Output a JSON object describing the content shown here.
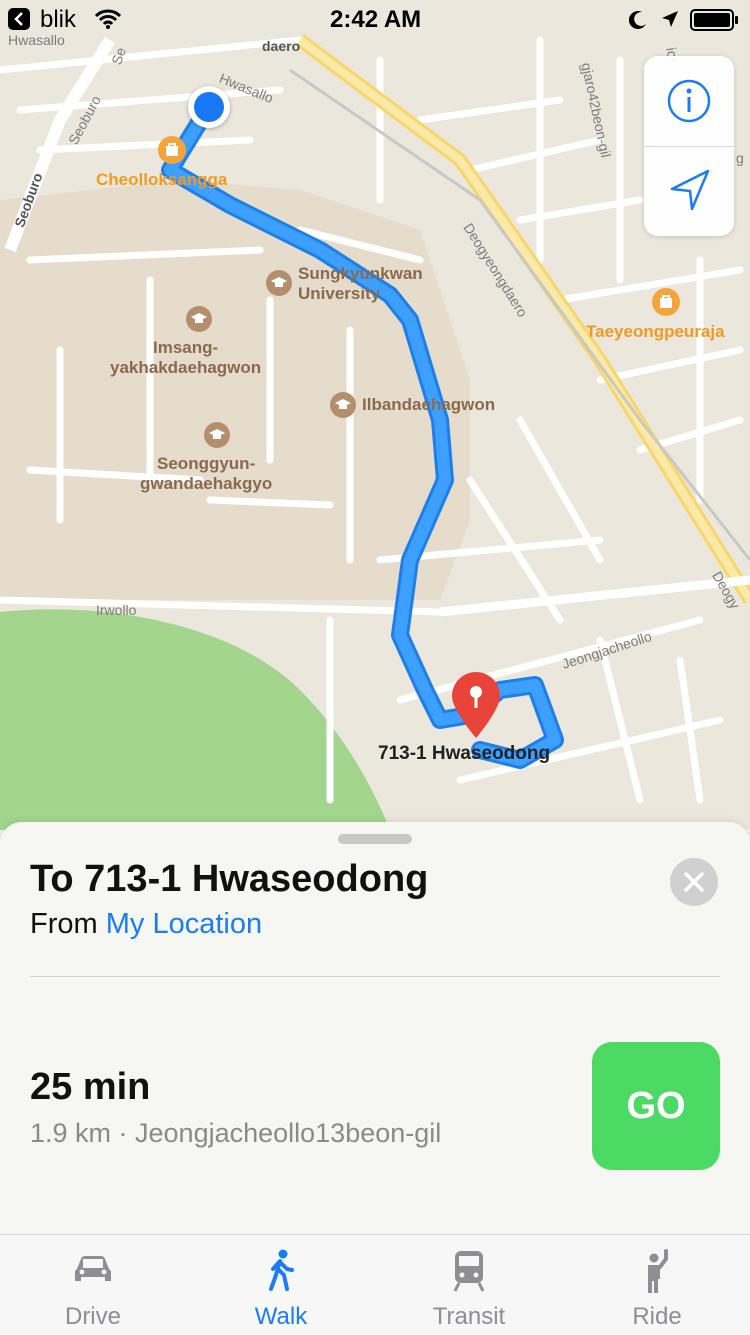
{
  "status_bar": {
    "back_app": "blik",
    "time": "2:42 AM"
  },
  "map": {
    "places": {
      "cheolloksangga": "Cheolloksangga",
      "sungkyunkwan": "Sungkyunkwan\nUniversity",
      "imsang": "Imsang-\nyakhakdaehagwon",
      "ilbanda": "Ilbandaehagwon",
      "seonggyun": "Seonggyun-\ngwandaehakgyo",
      "taeyeong": "Taeyeongpeuraja",
      "destination": "713-1 Hwaseodong"
    },
    "roads": {
      "hwasallo": "Hwasallo",
      "hwasallo_top": "Hwasallo",
      "seoburo": "Seoburo",
      "seoburo_left": "Seoburo",
      "se": "Se",
      "daero": "daero",
      "gjaro": "gjaro42beon-gil",
      "deogyeong": "Deogyeongdaero",
      "deogyeong_edge": "Deogy",
      "irwollo": "Irwollo",
      "jeongjache": "Jeongjacheollo",
      "edge_ick": "ick",
      "edge_g": "g"
    },
    "colors": {
      "route": "#2f8ff5",
      "user_dot": "#1877f2",
      "pin": "#e8443a",
      "park": "#9ed38a",
      "campus": "#e6dccb"
    }
  },
  "controls": {
    "info_icon": "info-icon",
    "locate_icon": "location-arrow-icon"
  },
  "card": {
    "title": "To 713-1 Hwaseodong",
    "from_label": "From",
    "from_value": "My Location",
    "duration": "25 min",
    "route_meta": "1.9 km · Jeongjacheollo13beon-gil",
    "go_label": "GO"
  },
  "tabs": [
    {
      "label": "Drive",
      "icon": "car-icon",
      "active": false
    },
    {
      "label": "Walk",
      "icon": "walk-icon",
      "active": true
    },
    {
      "label": "Transit",
      "icon": "train-icon",
      "active": false
    },
    {
      "label": "Ride",
      "icon": "hail-icon",
      "active": false
    }
  ]
}
